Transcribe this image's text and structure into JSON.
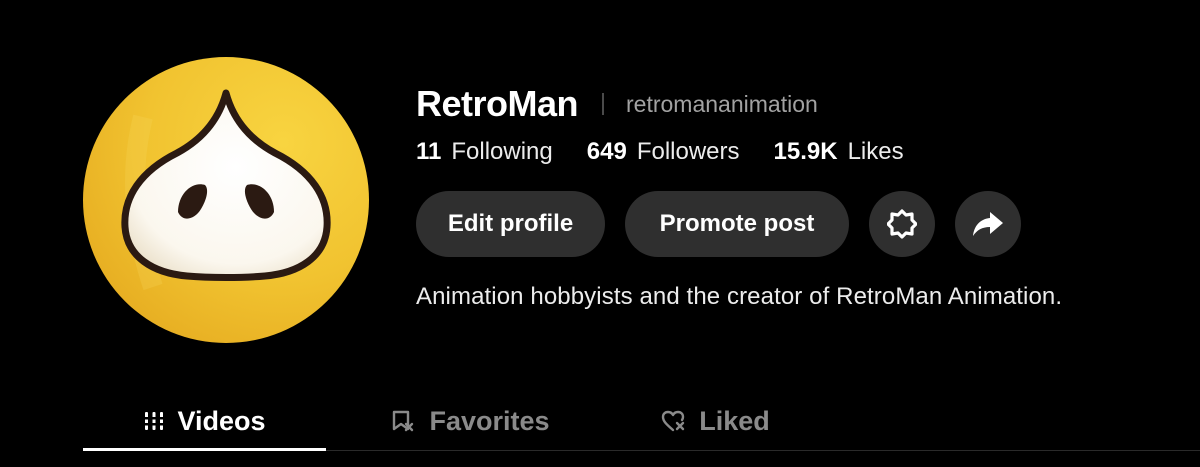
{
  "profile": {
    "display_name": "RetroMan",
    "username": "retromananimation",
    "bio": "Animation hobbyists and the creator of RetroMan Animation."
  },
  "stats": [
    {
      "value": "11",
      "label": "Following"
    },
    {
      "value": "649",
      "label": "Followers"
    },
    {
      "value": "15.9K",
      "label": "Likes"
    }
  ],
  "actions": {
    "edit_label": "Edit profile",
    "promote_label": "Promote post",
    "settings_icon": "gear-icon",
    "share_icon": "share-arrow-icon"
  },
  "tabs": [
    {
      "label": "Videos",
      "icon": "grid-bars-icon",
      "active": true
    },
    {
      "label": "Favorites",
      "icon": "bookmark-icon",
      "active": false
    },
    {
      "label": "Liked",
      "icon": "heart-icon",
      "active": false
    }
  ],
  "colors": {
    "background": "#000000",
    "button": "#2f2f2f",
    "avatar_yellow": "#f2c530",
    "muted_text": "#a2a2a2"
  }
}
